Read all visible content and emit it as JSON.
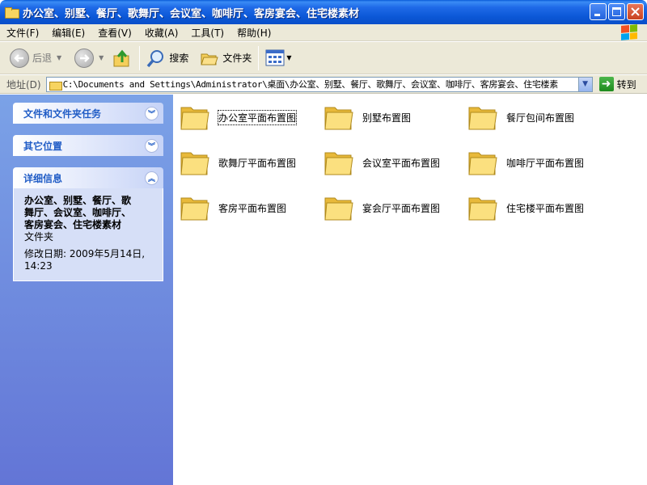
{
  "window": {
    "title": "办公室、别墅、餐厅、歌舞厅、会议室、咖啡厅、客房宴会、住宅楼素材"
  },
  "menu": [
    "文件(F)",
    "编辑(E)",
    "查看(V)",
    "收藏(A)",
    "工具(T)",
    "帮助(H)"
  ],
  "toolbar": {
    "back": "后退",
    "search": "搜索",
    "folders": "文件夹"
  },
  "address": {
    "label": "地址(D)",
    "path": "C:\\Documents and Settings\\Administrator\\桌面\\办公室、别墅、餐厅、歌舞厅、会议室、咖啡厅、客房宴会、住宅楼素",
    "go": "转到"
  },
  "sidebar": {
    "tasks_title": "文件和文件夹任务",
    "other_title": "其它位置",
    "details_title": "详细信息",
    "detail_name_lines": [
      "办公室、别墅、餐厅、歌",
      "舞厅、会议室、咖啡厅、",
      "客房宴会、住宅楼素材"
    ],
    "detail_type": "文件夹",
    "detail_date_lines": [
      "修改日期: 2009年5月14日,",
      "14:23"
    ]
  },
  "files": [
    {
      "name": "办公室平面布置图"
    },
    {
      "name": "别墅布置图"
    },
    {
      "name": "餐厅包间布置图"
    },
    {
      "name": "歌舞厅平面布置图"
    },
    {
      "name": "会议室平面布置图"
    },
    {
      "name": "咖啡厅平面布置图"
    },
    {
      "name": "客房平面布置图"
    },
    {
      "name": "宴会厅平面布置图"
    },
    {
      "name": "住宅楼平面布置图"
    }
  ]
}
